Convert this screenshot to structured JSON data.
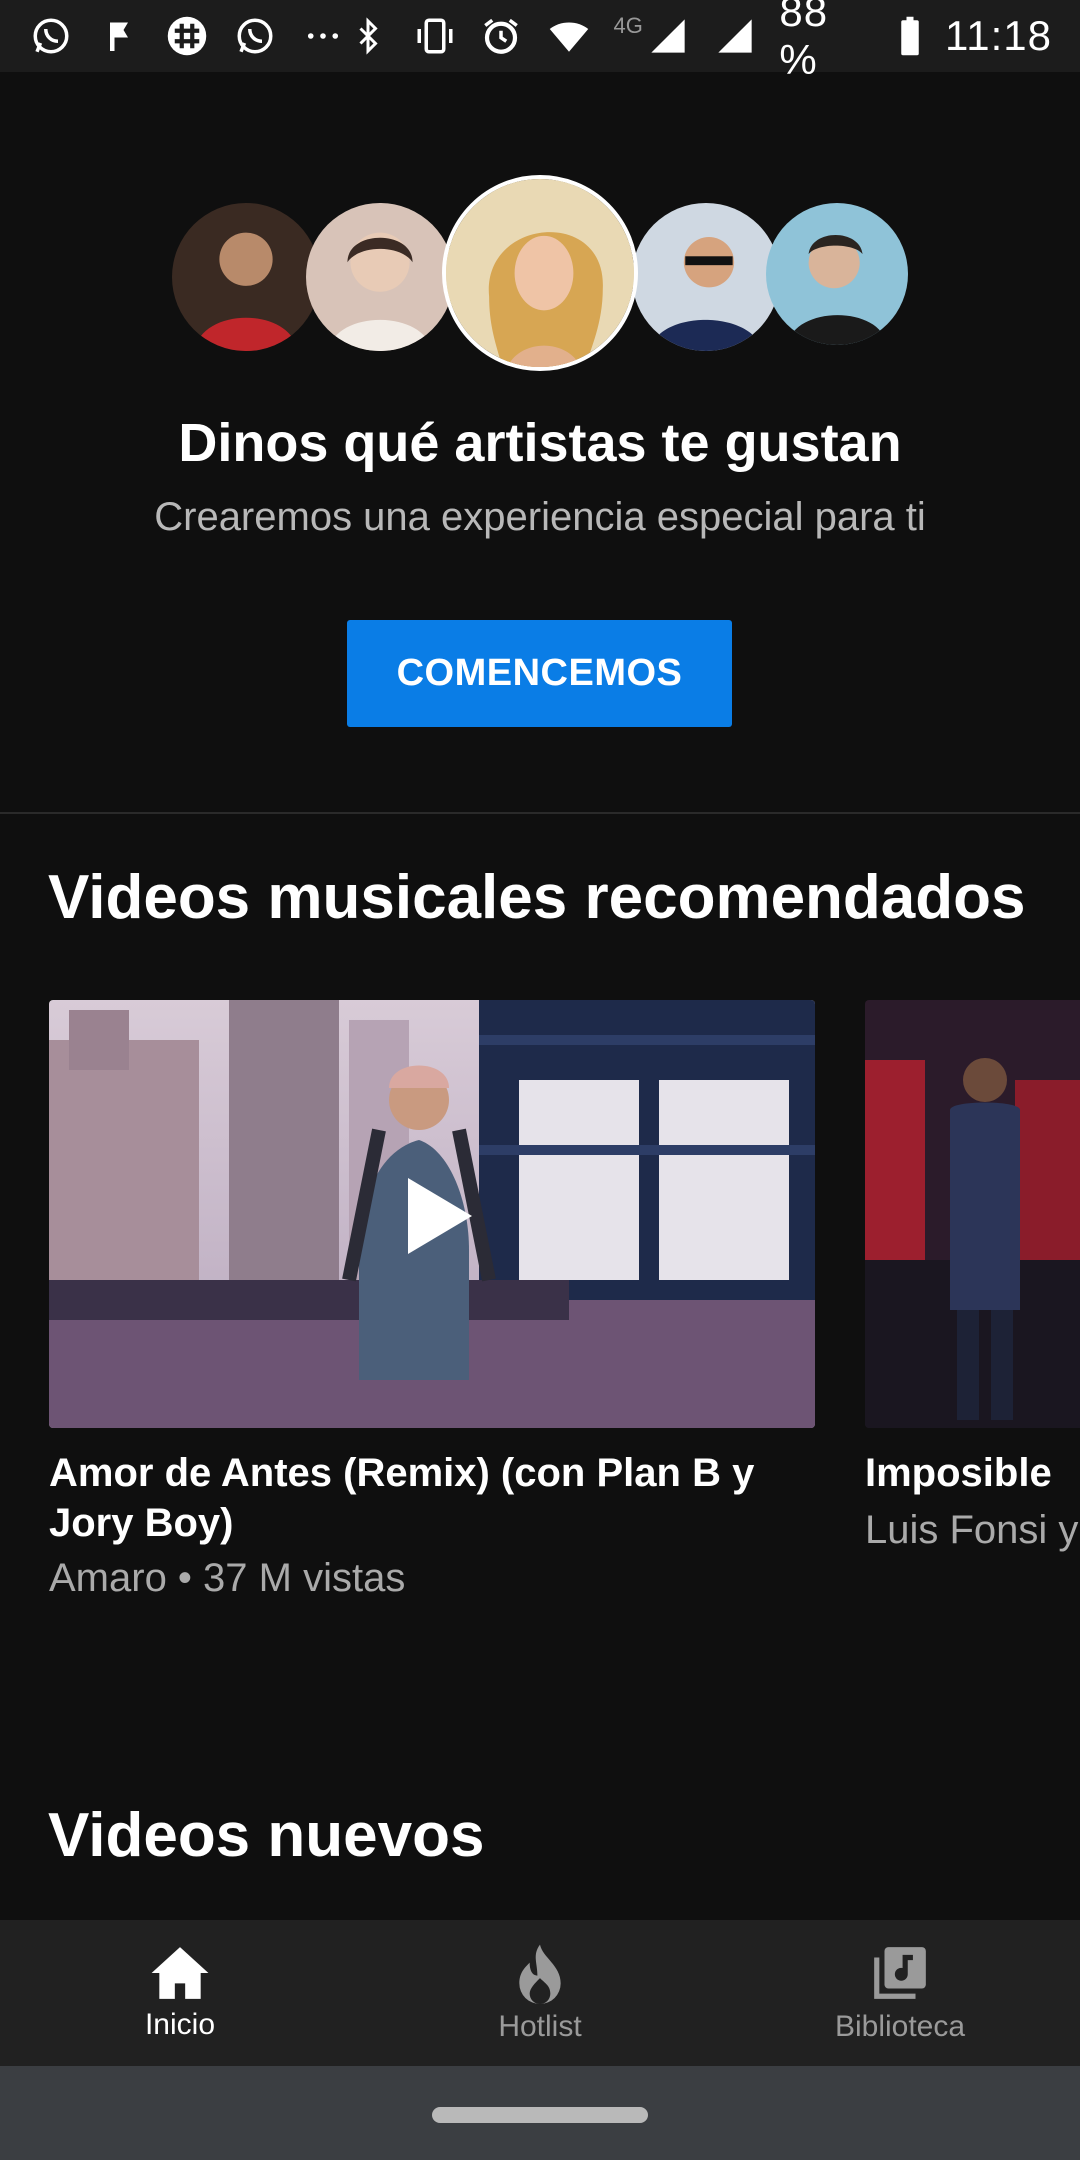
{
  "status_bar": {
    "left_icons": [
      "whatsapp-icon",
      "flag-icon",
      "slack-icon",
      "whatsapp-icon",
      "more-icon"
    ],
    "right_icons": [
      "bluetooth-icon",
      "vibrate-icon",
      "alarm-icon",
      "wifi-icon",
      "signal-icon",
      "signal-icon",
      "battery-icon"
    ],
    "network": "4G",
    "battery": "88 %",
    "time": "11:18"
  },
  "onboarding": {
    "title": "Dinos qué artistas te gustan",
    "subtitle": "Crearemos una experiencia especial para ti",
    "cta_label": "COMENCEMOS"
  },
  "recommended": {
    "title": "Videos musicales recomendados",
    "videos": [
      {
        "title": "Amor de Antes (Remix) (con Plan B y Jory Boy)",
        "meta": "Amaro • 37 M vistas"
      },
      {
        "title": "Imposible",
        "meta": "Luis Fonsi y"
      }
    ]
  },
  "new_videos": {
    "title": "Videos nuevos"
  },
  "bottom_nav": {
    "items": [
      {
        "label": "Inicio",
        "icon": "home-icon",
        "active": true
      },
      {
        "label": "Hotlist",
        "icon": "flame-icon",
        "active": false
      },
      {
        "label": "Biblioteca",
        "icon": "library-icon",
        "active": false
      }
    ]
  },
  "colors": {
    "background": "#0f0f0f",
    "accent": "#0a7de6",
    "nav_bg": "#212121"
  }
}
